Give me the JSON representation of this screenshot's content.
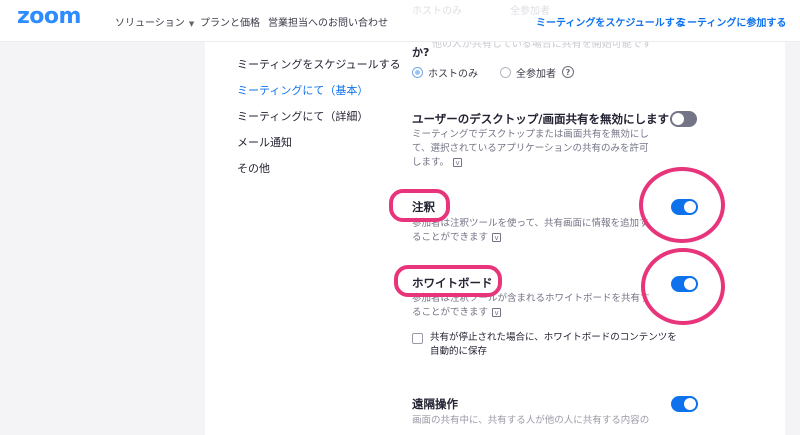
{
  "header": {
    "logo": "zoom",
    "nav": {
      "solutions": "ソリューション",
      "plans": "プランと価格",
      "contact_sales": "営業担当へのお問い合わせ"
    },
    "schedule_meeting": "ミーティングをスケジュールする",
    "join_meeting": "ミーティングに参加する",
    "faint_radio_host": "ホストのみ",
    "faint_radio_all": "全参加者"
  },
  "sidebar": {
    "items": [
      {
        "label": "ミーティングをスケジュールする",
        "active": false
      },
      {
        "label": "ミーティングにて（基本）",
        "active": true
      },
      {
        "label": "ミーティングにて（詳細）",
        "active": false
      },
      {
        "label": "メール通知",
        "active": false
      },
      {
        "label": "その他",
        "active": false
      }
    ]
  },
  "content": {
    "faded_line": "他の人が共有している場合に共有を開始可能です",
    "question_suffix": "か?",
    "radio_host_only": "ホストのみ",
    "radio_all_participants": "全参加者",
    "help_symbol": "?",
    "settings": [
      {
        "title": "ユーザーのデスクトップ/画面共有を無効にします",
        "desc": "ミーティングでデスクトップまたは画面共有を無効にして、選択されているアプリケーションの共有のみを許可します。",
        "enabled": false
      },
      {
        "title": "注釈",
        "desc": "参加者は注釈ツールを使って、共有画面に情報を追加することができます",
        "enabled": true
      },
      {
        "title": "ホワイトボード",
        "desc": "参加者は注釈ツールが含まれるホワイトボードを共有することができます",
        "enabled": true
      },
      {
        "title": "遠隔操作",
        "desc": "画面の共有中に、共有する人が他の人に共有する内容の",
        "enabled": true
      }
    ],
    "whiteboard_checkbox": "共有が停止された場合に、ホワイトボードのコンテンツを自動的に保存",
    "v_icon": "v"
  },
  "colors": {
    "brand": "#2d8cff",
    "link": "#0e72ed",
    "toggle_on": "#0e72ed",
    "toggle_off": "#747487",
    "highlight": "#e8347a"
  }
}
